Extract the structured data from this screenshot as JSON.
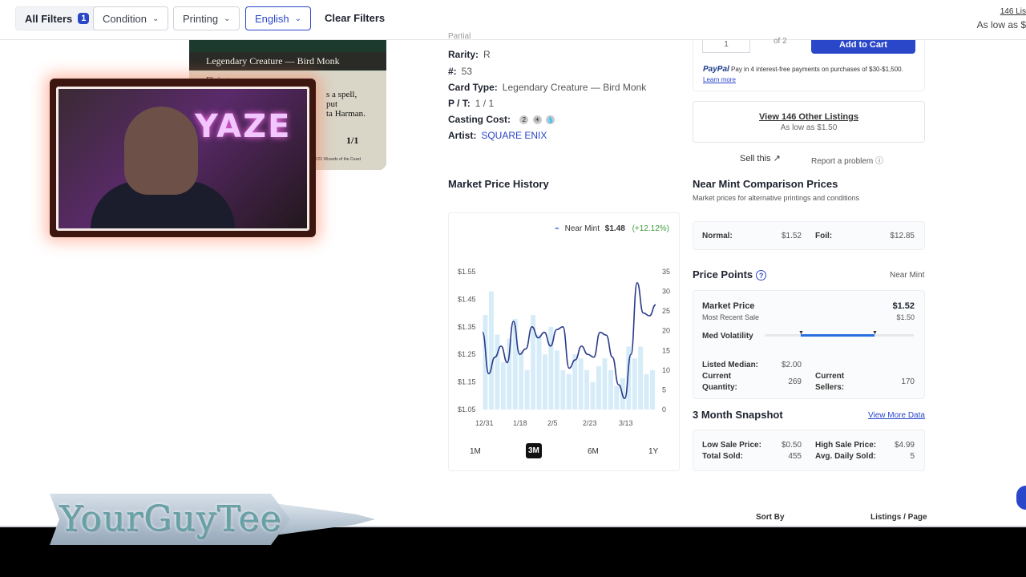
{
  "filters": {
    "all_label": "All Filters",
    "all_count": "1",
    "condition": "Condition",
    "printing": "Printing",
    "language": "English",
    "clear": "Clear Filters"
  },
  "top_right": {
    "listings": "146 Lis",
    "as_low": "As low as $"
  },
  "card_image": {
    "type_line": "Legendary Creature — Bird Monk",
    "ability": "Flying",
    "text_frag1": "s a spell, put",
    "text_frag2": "ta Harman.",
    "pt": "1/1",
    "footer": "© 2025 Wizards of the Coast"
  },
  "webcam": {
    "neon_text": "YAZE"
  },
  "details": {
    "partial_top": "Partial",
    "rarity_label": "Rarity:",
    "rarity": "R",
    "number_label": "#:",
    "number": "53",
    "type_label": "Card Type:",
    "type": "Legendary Creature — Bird Monk",
    "pt_label": "P / T:",
    "pt": "1 / 1",
    "cost_label": "Casting Cost:",
    "cost_symbols": [
      "2",
      "✳",
      "💧"
    ],
    "artist_label": "Artist:",
    "artist": "SQUARE ENIX"
  },
  "chart": {
    "title": "Market Price History",
    "legend_label": "Near Mint",
    "legend_value": "$1.48",
    "legend_change": "(+12.12%)",
    "ranges": [
      "1M",
      "3M",
      "6M",
      "1Y"
    ],
    "active_range": "3M"
  },
  "chart_data": {
    "type": "line",
    "x_ticks": [
      "12/31",
      "1/18",
      "2/5",
      "2/23",
      "3/13"
    ],
    "y_left_ticks": [
      "$1.55",
      "$1.45",
      "$1.35",
      "$1.25",
      "$1.15",
      "$1.05"
    ],
    "y_right_ticks": [
      "35",
      "30",
      "25",
      "20",
      "15",
      "10",
      "5",
      "0"
    ],
    "ylim": [
      1.05,
      1.55
    ],
    "y2lim": [
      0,
      35
    ],
    "series": [
      {
        "name": "Near Mint",
        "values": [
          1.33,
          1.18,
          1.24,
          1.28,
          1.22,
          1.37,
          1.25,
          1.27,
          1.35,
          1.31,
          1.33,
          1.28,
          1.34,
          1.35,
          1.2,
          1.23,
          1.28,
          1.25,
          1.24,
          1.33,
          1.32,
          1.24,
          1.14,
          1.09,
          1.25,
          1.51,
          1.4,
          1.39,
          1.43
        ]
      }
    ],
    "volume": [
      24,
      30,
      19,
      12,
      18,
      23,
      15,
      10,
      24,
      19,
      14,
      21,
      15,
      10,
      9,
      14,
      13,
      10,
      7,
      11,
      13,
      10,
      6,
      8,
      16,
      13,
      16,
      9,
      10
    ]
  },
  "buy": {
    "qty": "1",
    "of": "of 2",
    "add_to_cart": "Add to Cart",
    "paypal_brand": "PayPal",
    "paypal_text": "Pay in 4 interest-free payments on purchases of $30-$1,500.",
    "paypal_link": "Learn more"
  },
  "other_listings": {
    "title": "View 146 Other Listings",
    "sub": "As low as $1.50"
  },
  "links": {
    "sell": "Sell this",
    "report": "Report a problem"
  },
  "nm_comparison": {
    "title": "Near Mint Comparison Prices",
    "subtitle": "Market prices for alternative printings and conditions",
    "normal_label": "Normal:",
    "normal": "$1.52",
    "foil_label": "Foil:",
    "foil": "$12.85"
  },
  "price_points": {
    "title": "Price Points",
    "condition": "Near Mint",
    "market_label": "Market Price",
    "market": "$1.52",
    "recent_label": "Most Recent Sale",
    "recent": "$1.50",
    "volatility_label": "Med Volatility",
    "listed_median_label": "Listed Median:",
    "listed_median": "$2.00",
    "current_qty_label1": "Current",
    "current_qty_label2": "Quantity:",
    "current_qty": "269",
    "current_sellers_label1": "Current",
    "current_sellers_label2": "Sellers:",
    "current_sellers": "170"
  },
  "snapshot": {
    "title": "3 Month Snapshot",
    "view_more": "View More Data",
    "low_label": "Low Sale Price:",
    "low": "$0.50",
    "high_label": "High Sale Price:",
    "high": "$4.99",
    "sold_label": "Total Sold:",
    "sold": "455",
    "avg_label": "Avg. Daily Sold:",
    "avg": "5"
  },
  "listings_bar": {
    "sort_by": "Sort By",
    "per_page": "Listings / Page"
  },
  "overlay": {
    "banner_text": "YourGuyTee"
  },
  "colors": {
    "accent": "#2a46c9",
    "chart_line": "#2a3a8a",
    "volume_bar": "#d6ecf8",
    "positive": "#3a9a3a"
  }
}
